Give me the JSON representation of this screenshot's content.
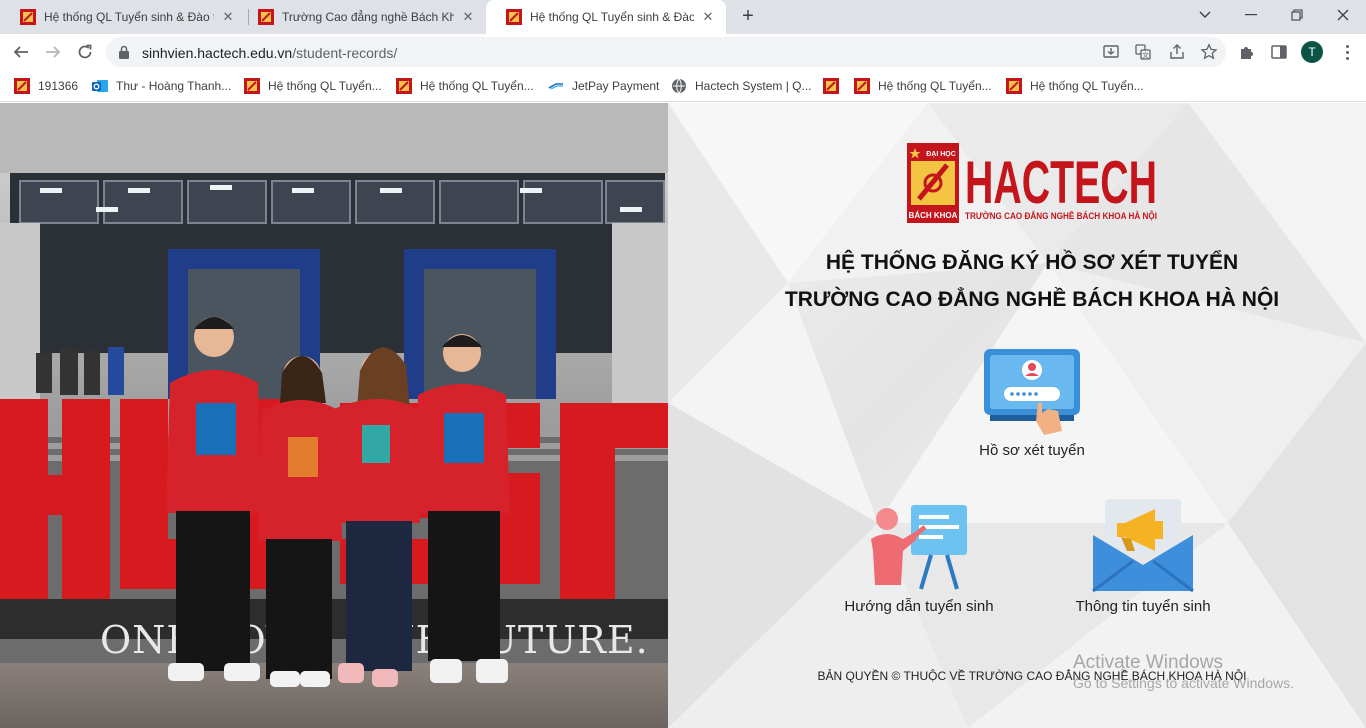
{
  "tabs": [
    {
      "title": "Hệ thống QL Tuyển sinh & Đào tạo",
      "active": false
    },
    {
      "title": "Trường Cao đẳng nghề Bách Khoa",
      "active": false
    },
    {
      "title": "Hệ thống QL Tuyển sinh & Đào Tạo",
      "active": true
    }
  ],
  "toolbar": {
    "url_host": "sinhvien.hactech.edu.vn",
    "url_path": "/student-records/",
    "profile_initial": "T"
  },
  "bookmarks": [
    {
      "label": "191366",
      "icon": "hactech-favicon"
    },
    {
      "label": "Thư - Hoàng Thanh...",
      "icon": "outlook-icon"
    },
    {
      "label": "Hệ thống QL Tuyển...",
      "icon": "hactech-favicon"
    },
    {
      "label": "Hệ thống QL Tuyển...",
      "icon": "hactech-favicon"
    },
    {
      "label": "JetPay Payment",
      "icon": "jetpay-icon"
    },
    {
      "label": "Hactech System | Q...",
      "icon": "globe-icon"
    },
    {
      "label": "",
      "icon": "hactech-favicon"
    },
    {
      "label": "Hệ thống QL Tuyển...",
      "icon": "hactech-favicon"
    },
    {
      "label": "Hệ thống QL Tuyển...",
      "icon": "hactech-favicon"
    }
  ],
  "photo": {
    "slogan": "ONE LOVE. ONE FUTURE."
  },
  "logo": {
    "wordmark": "HACTECH",
    "tagline": "TRƯỜNG CAO ĐẲNG NGHỀ BÁCH KHOA HÀ NỘI",
    "badge_top": "ĐẠI HỌC",
    "badge_bottom": "BÁCH KHOA"
  },
  "page": {
    "heading_line1": "HỆ THỐNG ĐĂNG KÝ HỒ SƠ XÉT TUYỂN",
    "heading_line2": "TRƯỜNG CAO ĐẲNG NGHỀ BÁCH KHOA HÀ NỘI",
    "menu": [
      {
        "label": "Hồ sơ xét tuyển",
        "icon": "profile-login-icon"
      },
      {
        "label": "Hướng dẫn tuyển sinh",
        "icon": "presentation-icon"
      },
      {
        "label": "Thông tin tuyển sinh",
        "icon": "megaphone-envelope-icon"
      }
    ],
    "footer": "BẢN QUYỀN © THUỘC VỀ TRƯỜNG CAO ĐẲNG NGHỀ BÁCH KHOA HÀ NỘI"
  },
  "watermark": {
    "line1": "Activate Windows",
    "line2": "Go to Settings to activate Windows."
  },
  "colors": {
    "brand_red": "#c4151c",
    "profile_green": "#0b5345"
  }
}
